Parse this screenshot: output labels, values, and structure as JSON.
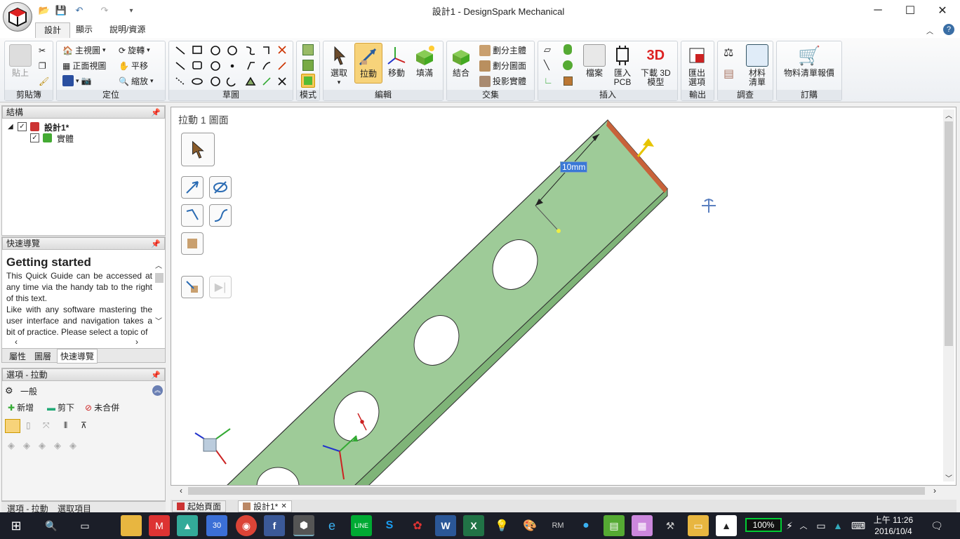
{
  "window": {
    "title": "設計1 - DesignSpark Mechanical",
    "minimize": "─",
    "maximize": "☐",
    "close": "✕",
    "help": "?"
  },
  "tabs": [
    {
      "label": "設計"
    },
    {
      "label": "顯示"
    },
    {
      "label": "說明/資源"
    }
  ],
  "ribbon": {
    "clipboard": {
      "label": "剪貼簿",
      "paste": "貼上"
    },
    "orient": {
      "label": "定位",
      "home": "主視圖",
      "front": "正面視圖",
      "spin": "旋轉",
      "pan": "平移",
      "zoom": "縮放"
    },
    "sketch": {
      "label": "草圖"
    },
    "mode": {
      "label": "模式"
    },
    "edit": {
      "label": "編輯",
      "select": "選取",
      "pull": "拉動",
      "move": "移動",
      "fill": "填滿"
    },
    "intersect": {
      "label": "交集",
      "combine": "結合",
      "split_body": "劃分主體",
      "split_face": "劃分圖面",
      "project": "投影實體"
    },
    "insert": {
      "label": "插入",
      "file": "檔案",
      "pcb": "匯入\nPCB",
      "model3d": "下載 3D\n模型"
    },
    "output": {
      "label": "輸出",
      "export": "匯出\n選項"
    },
    "investigate": {
      "label": "調查",
      "bom": "材料\n清單"
    },
    "order": {
      "label": "訂購",
      "bomquote": "物料清單報價"
    }
  },
  "structure": {
    "header": "結構",
    "root": "設計1*",
    "child": "實體"
  },
  "quickguide": {
    "header": "快速導覽",
    "title": "Getting started",
    "p1": "This Quick Guide can be accessed at any time via the handy tab to the right of this text.",
    "p2": "Like with any software mastering the user interface and navigation takes a bit of practice. Please select a topic of",
    "tabs": [
      "屬性",
      "圖層",
      "快速導覽"
    ]
  },
  "options": {
    "header": "選項 - 拉動",
    "section": "一般",
    "add": "新增",
    "cut": "剪下",
    "nomerge": "未合併"
  },
  "bottomtabs": [
    "選項 - 拉動",
    "選取項目"
  ],
  "viewport": {
    "mode_label": "拉動 1 圖面",
    "dimension": "10mm",
    "tabs": [
      "起始頁面",
      "設計1*"
    ]
  },
  "taskbar": {
    "battery": "100%",
    "time": "上午 11:26",
    "date": "2016/10/4",
    "calendar_day": "30"
  }
}
